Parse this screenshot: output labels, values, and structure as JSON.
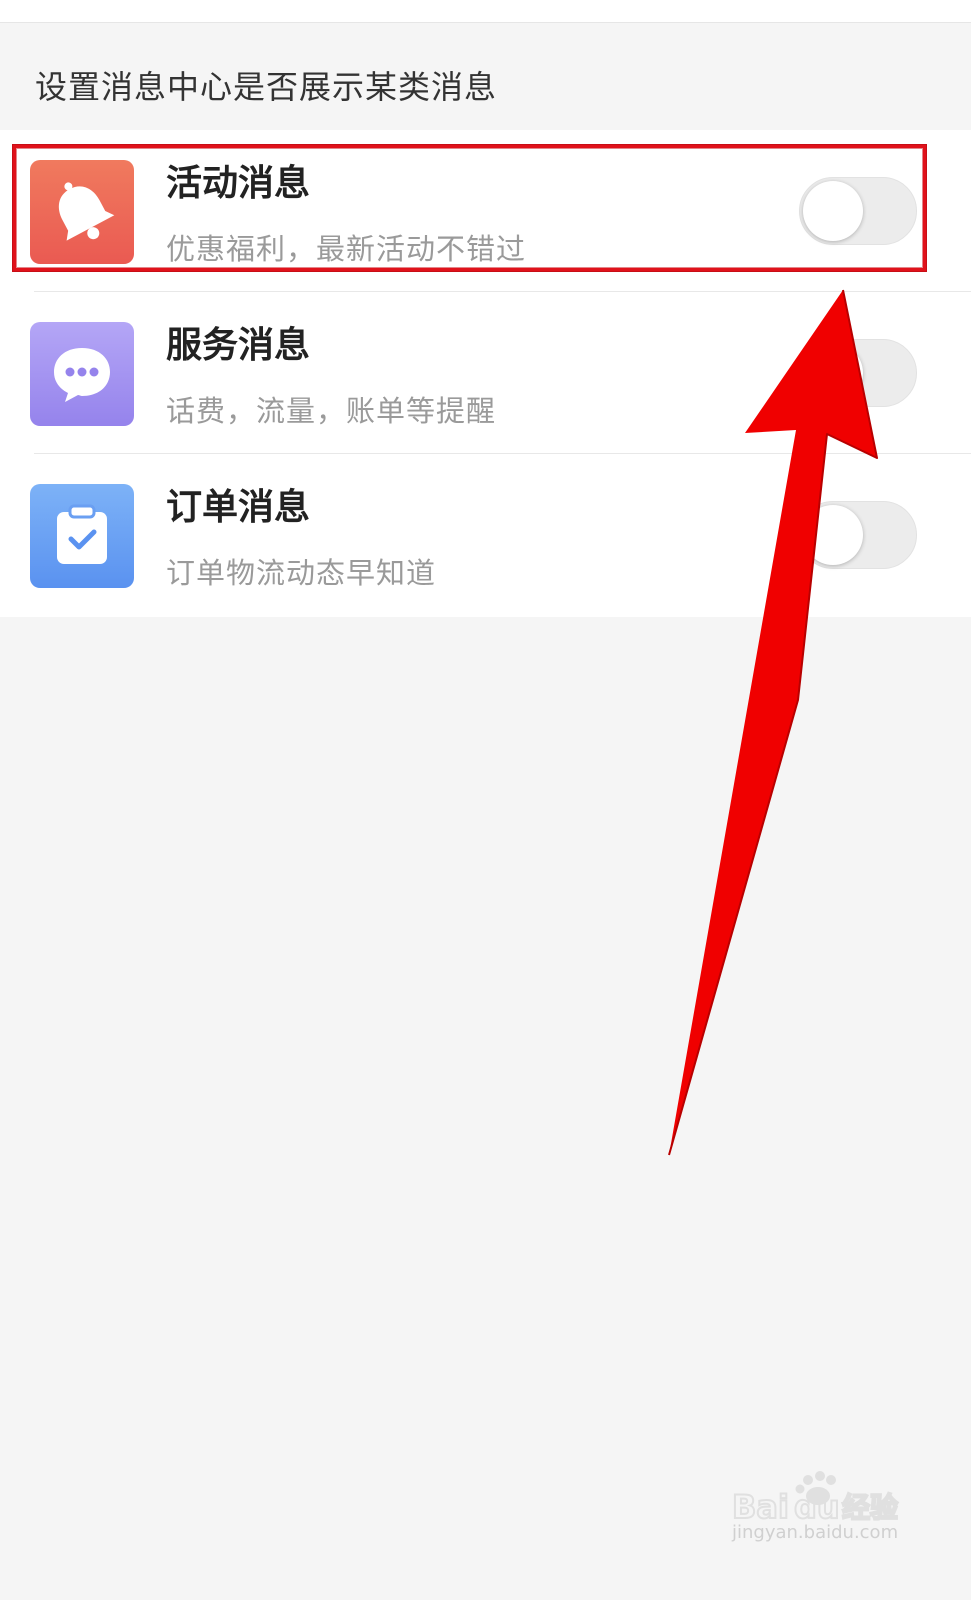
{
  "section_header": "设置消息中心是否展示某类消息",
  "rows": [
    {
      "title": "活动消息",
      "subtitle": "优惠福利，最新活动不错过",
      "icon": "bell-icon",
      "icon_color_top": "#f07a5e",
      "icon_color_bottom": "#ea5a52",
      "toggle_on": false
    },
    {
      "title": "服务消息",
      "subtitle": "话费，流量，账单等提醒",
      "icon": "chat-bubble-icon",
      "icon_color_top": "#b4a6f6",
      "icon_color_bottom": "#9583ec",
      "toggle_on": false
    },
    {
      "title": "订单消息",
      "subtitle": "订单物流动态早知道",
      "icon": "clipboard-check-icon",
      "icon_color_top": "#7db2f7",
      "icon_color_bottom": "#5a92f0",
      "toggle_on": false
    }
  ],
  "annotation": {
    "highlight_color": "#e0121b",
    "arrow_color": "#f00000"
  },
  "watermark": {
    "brand": "Baidu经验",
    "url": "jingyan.baidu.com"
  }
}
